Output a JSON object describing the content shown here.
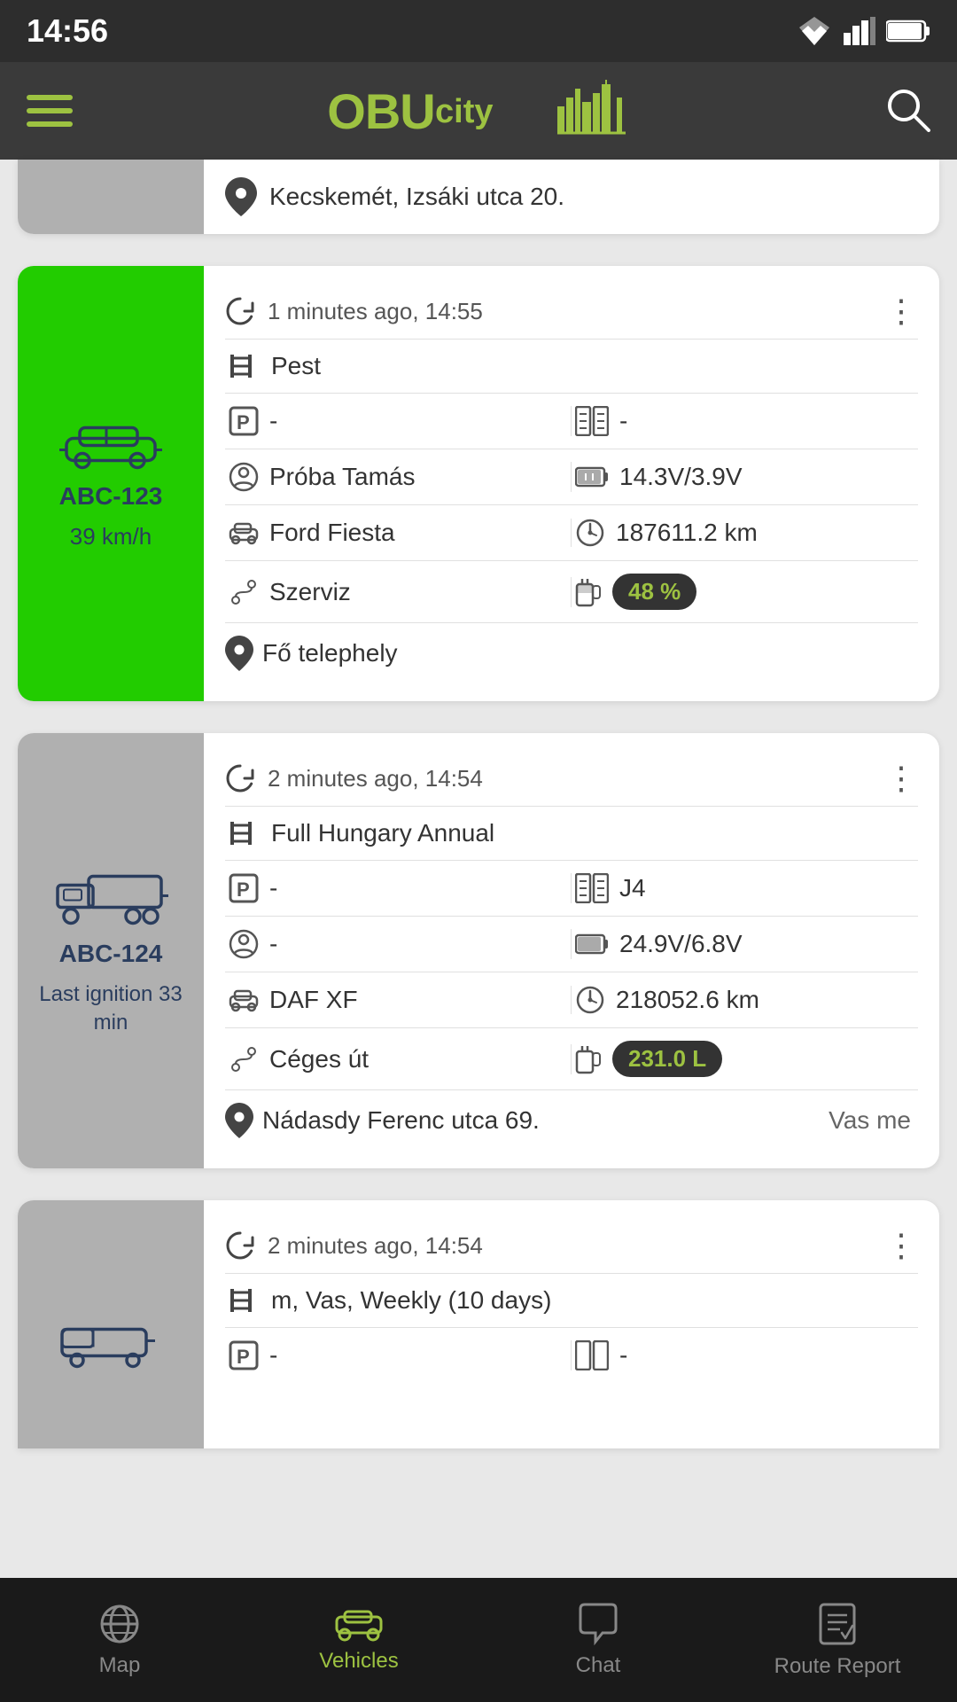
{
  "statusBar": {
    "time": "14:56"
  },
  "topNav": {
    "logoText": "OBU",
    "logoSub": "city"
  },
  "partialCard": {
    "location": "Kecskemét, Izsáki utca 20."
  },
  "cards": [
    {
      "id": "card-1",
      "sidebarColor": "green",
      "vehicleType": "car",
      "plate": "ABC-123",
      "speed": "39 km/h",
      "status": null,
      "timestamp": "1 minutes ago, 14:55",
      "roadType": "Pest",
      "parking": "-",
      "gear": "-",
      "driver": "Próba Tamás",
      "voltage": "14.3V/3.9V",
      "model": "Ford Fiesta",
      "odometer": "187611.2 km",
      "route": "Szerviz",
      "fuel": "48 %",
      "fuelUnit": "%",
      "location": "Fő telephely",
      "countyText": ""
    },
    {
      "id": "card-2",
      "sidebarColor": "gray",
      "vehicleType": "truck",
      "plate": "ABC-124",
      "speed": null,
      "status": "Last ignition 33 min",
      "timestamp": "2 minutes ago, 14:54",
      "roadType": "Full Hungary Annual",
      "parking": "-",
      "gear": "J4",
      "driver": "-",
      "voltage": "24.9V/6.8V",
      "model": "DAF XF",
      "odometer": "218052.6 km",
      "route": "Céges út",
      "fuel": "231.0 L",
      "fuelUnit": "L",
      "location": "Nádasdy Ferenc utca 69.",
      "countyText": "Vas me"
    }
  ],
  "partialCard3": {
    "timestamp": "2 minutes ago, 14:54",
    "roadType": "m, Vas, Weekly (10 days)",
    "parking": "-",
    "gear": "-",
    "vehicleType": "van",
    "sidebarColor": "gray"
  },
  "bottomNav": {
    "items": [
      {
        "id": "map",
        "label": "Map",
        "icon": "globe"
      },
      {
        "id": "vehicles",
        "label": "Vehicles",
        "icon": "car",
        "active": true
      },
      {
        "id": "chat",
        "label": "Chat",
        "icon": "chat"
      },
      {
        "id": "route-report",
        "label": "Route Report",
        "icon": "report"
      }
    ]
  }
}
